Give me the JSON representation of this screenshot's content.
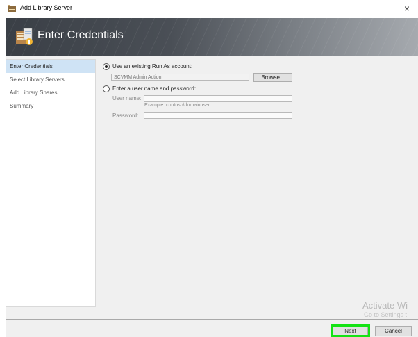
{
  "window": {
    "title": "Add Library Server",
    "close_glyph": "×",
    "icon": "library-server-icon"
  },
  "banner": {
    "title": "Enter Credentials",
    "icon": "credentials-wizard-icon"
  },
  "nav": {
    "items": [
      {
        "label": "Enter Credentials",
        "active": true
      },
      {
        "label": "Select Library Servers",
        "active": false
      },
      {
        "label": "Add Library Shares",
        "active": false
      },
      {
        "label": "Summary",
        "active": false
      }
    ]
  },
  "form": {
    "runas_option_label": "Use an existing Run As account:",
    "runas_value": "SCVMM Admin Action",
    "browse_label": "Browse...",
    "manual_option_label": "Enter a user name and password:",
    "username_label": "User name:",
    "username_value": "",
    "username_hint": "Example: contoso\\domainuser",
    "password_label": "Password:",
    "password_value": ""
  },
  "footer": {
    "next_label": "Next",
    "cancel_label": "Cancel"
  },
  "watermark": {
    "line1": "Activate Wi",
    "line2": "Go to Settings t"
  },
  "colors": {
    "nav_active": "#cfe3f5",
    "highlight": "#14e314"
  }
}
